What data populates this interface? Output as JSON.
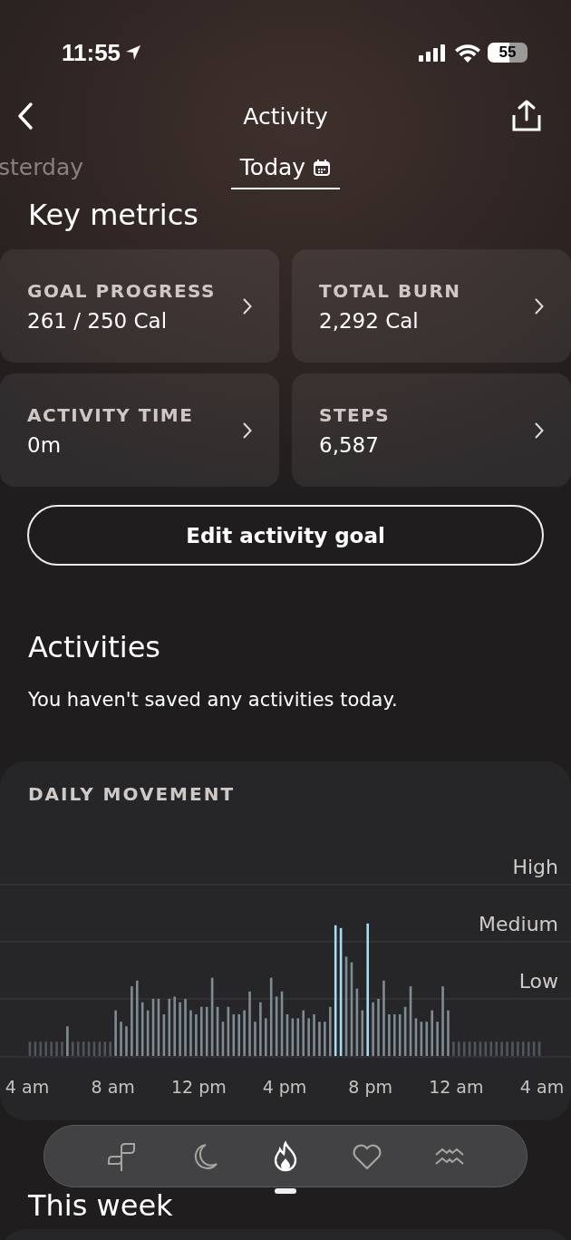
{
  "status_bar": {
    "time": "11:55",
    "battery": "55"
  },
  "header": {
    "title": "Activity"
  },
  "date_tabs": [
    {
      "label": "sterday",
      "selected": false
    },
    {
      "label": "Today",
      "selected": true
    }
  ],
  "key_metrics": {
    "title": "Key metrics",
    "cards": [
      {
        "label": "GOAL PROGRESS",
        "value": "261 / 250 Cal"
      },
      {
        "label": "TOTAL BURN",
        "value": "2,292 Cal"
      },
      {
        "label": "ACTIVITY TIME",
        "value": "0m"
      },
      {
        "label": "STEPS",
        "value": "6,587"
      }
    ]
  },
  "edit_button": "Edit activity goal",
  "activities": {
    "title": "Activities",
    "empty_text": "You haven't saved any activities today."
  },
  "daily_movement": {
    "title": "DAILY MOVEMENT",
    "level_labels": [
      "High",
      "Medium",
      "Low"
    ],
    "time_labels": [
      "4 am",
      "8 am",
      "12 pm",
      "4 pm",
      "8 pm",
      "12 am",
      "4 am"
    ]
  },
  "this_week": {
    "title": "This week"
  },
  "bottom_nav": [
    {
      "selected": false
    },
    {
      "selected": false
    },
    {
      "selected": true
    },
    {
      "selected": false
    },
    {
      "selected": false
    }
  ]
}
